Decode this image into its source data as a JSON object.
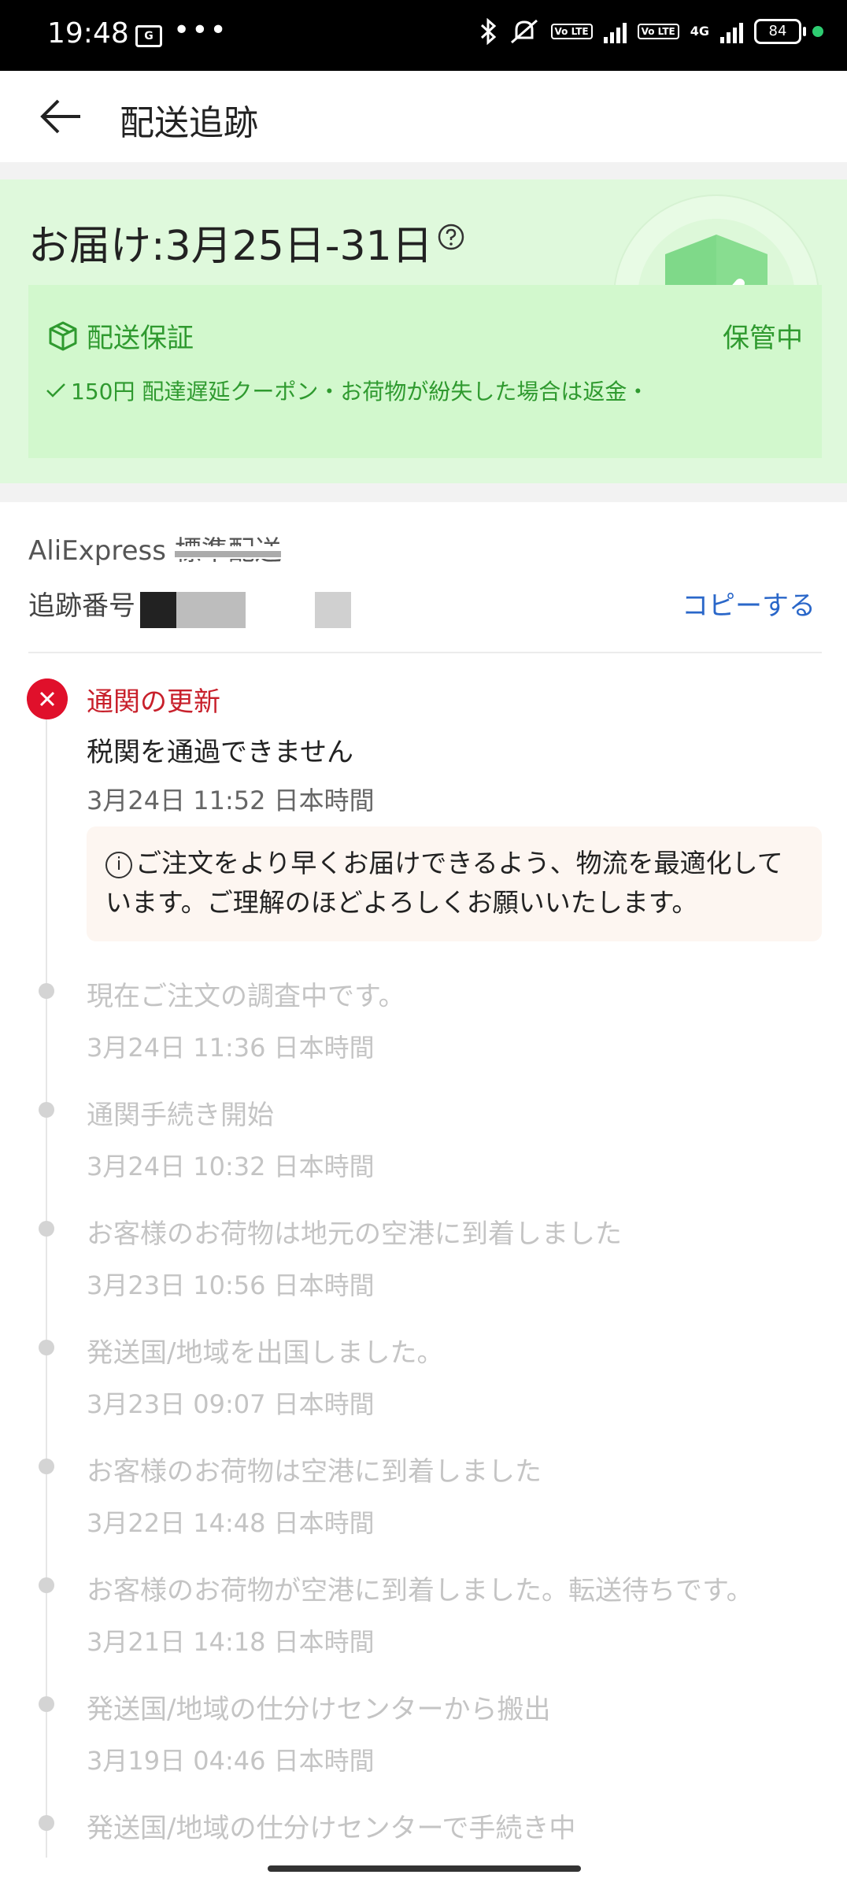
{
  "status_bar": {
    "time": "19:48",
    "sim_label": "G",
    "more": "•••",
    "network_label": "4G",
    "volte_label": "Vo LTE",
    "battery": "84"
  },
  "header": {
    "title": "配送追跡"
  },
  "delivery": {
    "estimate": "お届け:3月25日-31日"
  },
  "guarantee": {
    "title": "配送保証",
    "status": "保管中",
    "benefits": "150円 配達遅延クーポン・お荷物が紛失した場合は返金・"
  },
  "shipping": {
    "method": "AliExpress 標準配送",
    "tracking_label": "追跡番号",
    "copy_label": "コピーする"
  },
  "current_event": {
    "title": "通関の更新",
    "description": "税関を通過できません",
    "time": "3月24日 11:52 日本時間",
    "note": "ご注文をより早くお届けできるよう、物流を最適化しています。ご理解のほどよろしくお願いいたします。"
  },
  "events": [
    {
      "title": "現在ご注文の調査中です。",
      "time": "3月24日 11:36 日本時間"
    },
    {
      "title": "通関手続き開始",
      "time": "3月24日 10:32 日本時間"
    },
    {
      "title": "お客様のお荷物は地元の空港に到着しました",
      "time": "3月23日 10:56 日本時間"
    },
    {
      "title": "発送国/地域を出国しました。",
      "time": "3月23日 09:07 日本時間"
    },
    {
      "title": "お客様のお荷物は空港に到着しました",
      "time": "3月22日 14:48 日本時間"
    },
    {
      "title": "お客様のお荷物が空港に到着しました。転送待ちです。",
      "time": "3月21日 14:18 日本時間"
    },
    {
      "title": "発送国/地域の仕分けセンターから搬出",
      "time": "3月19日 04:46 日本時間"
    },
    {
      "title": "発送国/地域の仕分けセンターで手続き中",
      "time": ""
    }
  ],
  "colors": {
    "accent_green": "#2f9a2f",
    "error_red": "#e0102b",
    "link_blue": "#2a67c9",
    "green_bg": "#dff9dc"
  }
}
